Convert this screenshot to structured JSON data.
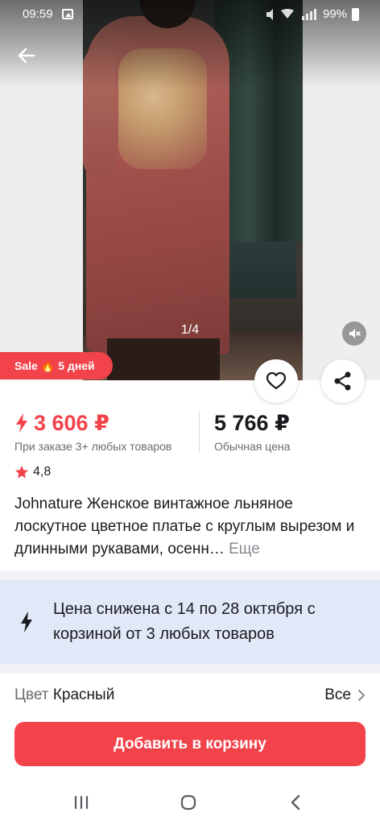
{
  "status_bar": {
    "time": "09:59",
    "battery": "99%",
    "icons": [
      "gallery-icon",
      "mute-icon",
      "wifi-icon",
      "signal-icon",
      "battery-icon"
    ]
  },
  "gallery": {
    "counter": "1/4",
    "sale_badge": {
      "prefix": "Sale",
      "suffix": "5 дней",
      "icon": "fire-icon"
    }
  },
  "price": {
    "current": "3 606 ₽",
    "current_note": "При заказе 3+ любых товаров",
    "regular": "5 766 ₽",
    "regular_note": "Обычная цена"
  },
  "rating": "4,8",
  "product": {
    "title": "Johnature Женское винтажное льняное лоскутное цветное платье с круглым вырезом и длинными рукавами, осенн…",
    "more": "Еще"
  },
  "promo": {
    "text": "Цена снижена с 14 по 28 октября с корзиной от 3 любых товаров"
  },
  "color": {
    "label": "Цвет",
    "value": "Красный",
    "all": "Все"
  },
  "cart_button": "Добавить в корзину",
  "colors": {
    "accent": "#f2434b",
    "promo_bg": "#e1e8f7",
    "muted_text": "#6a6a72"
  }
}
